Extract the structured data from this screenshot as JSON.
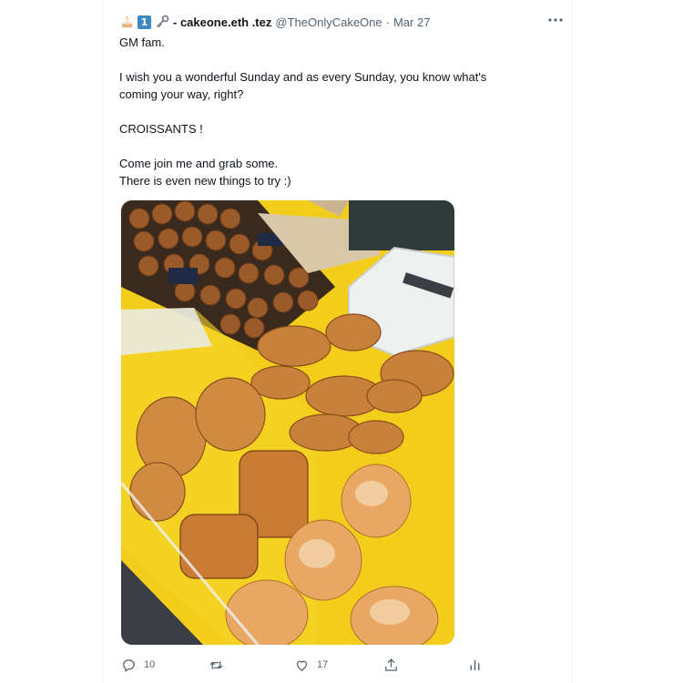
{
  "tweet": {
    "emojis": [
      "cake-emoji",
      "keycap-one-emoji",
      "key-emoji"
    ],
    "keycap_digit": "1",
    "display_name": "- cakeone.eth .tez",
    "handle": "@TheOnlyCakeOne",
    "separator": "·",
    "date": "Mar 27",
    "text_lines": {
      "line1": "GM fam.",
      "line2": "I wish you a wonderful Sunday and as every Sunday, you know what's",
      "line3": "coming your way, right?",
      "line4": "CROISSANTS !",
      "line5": "Come join me and grab some.",
      "line6": "There is even new things to try :)"
    },
    "media": {
      "description_icon": "pastry-photo",
      "label": "Bakery pastries display"
    },
    "actions": {
      "replies": "10",
      "retweets": "",
      "likes": "17",
      "share": "",
      "analytics": ""
    }
  },
  "colors": {
    "text": "#0f1419",
    "muted": "#536471",
    "keycap": "#3b88c3",
    "tray_yellow": "#f4cf1a"
  }
}
